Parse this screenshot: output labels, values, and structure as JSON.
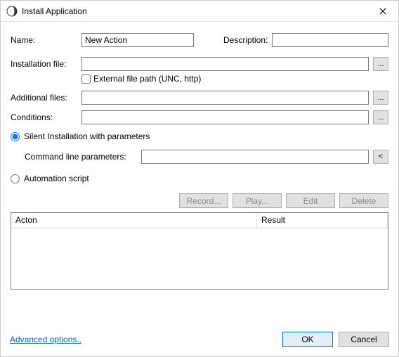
{
  "title": "Install Application",
  "labels": {
    "name": "Name:",
    "description": "Description:",
    "install_file": "Installation file:",
    "ext_path": "External file path (UNC, http)",
    "additional_files": "Additional files:",
    "conditions": "Conditions:",
    "silent": "Silent Installation with parameters",
    "cmd_params": "Command line parameters:",
    "automation": "Automation script"
  },
  "values": {
    "name": "New Action",
    "description": "",
    "install_file": "",
    "additional_files": "",
    "conditions": "",
    "cmd_params": "",
    "silent_selected": true,
    "automation_selected": false,
    "ext_path_checked": false
  },
  "browse": "...",
  "collapse": "<",
  "buttons": {
    "record": "Record...",
    "play": "Play...",
    "edit": "Edit",
    "delete": "Delete",
    "ok": "OK",
    "cancel": "Cancel"
  },
  "table": {
    "col_action": "Acton",
    "col_result": "Result",
    "rows": []
  },
  "advanced": "Advanced options.."
}
